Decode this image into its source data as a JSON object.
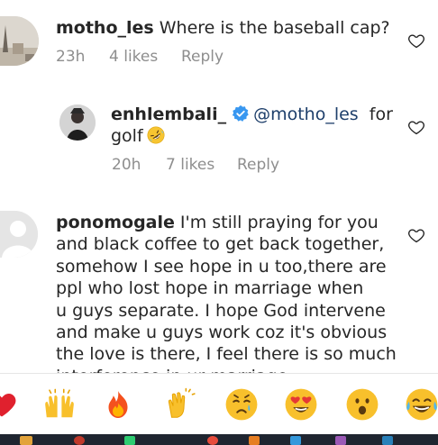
{
  "comments": [
    {
      "username": "motho_les",
      "text": "Where is the baseball cap?",
      "time": "23h",
      "likes": "4 likes",
      "reply": "Reply"
    },
    {
      "username": "enhlembali_",
      "mention": "@motho_les",
      "text_after_mention": "for",
      "text_line2": "golf",
      "time": "20h",
      "likes": "7 likes",
      "reply": "Reply",
      "verified": true,
      "emoji": "rolling-on-floor-laughing"
    },
    {
      "username": "ponomogale",
      "lines": [
        "I'm still praying for you",
        "and black coffee to get back together,",
        "somehow I see hope in u too,there are",
        "ppl who lost hope in marriage when",
        "u guys separate. I hope God intervene",
        "and make u guys work coz it's obvious",
        "the love is there, I feel there is so much",
        "interference in ur marriage"
      ]
    }
  ],
  "emoji_bar": [
    {
      "name": "red-heart"
    },
    {
      "name": "raising-hands"
    },
    {
      "name": "fire"
    },
    {
      "name": "clapping-hands"
    },
    {
      "name": "crying-face"
    },
    {
      "name": "heart-eyes"
    },
    {
      "name": "surprised-face"
    },
    {
      "name": "tears-of-joy"
    }
  ],
  "colors": {
    "text": "#262626",
    "meta": "#8e8e8e",
    "mention": "#1e3f6b",
    "verified": "#3897f0"
  }
}
